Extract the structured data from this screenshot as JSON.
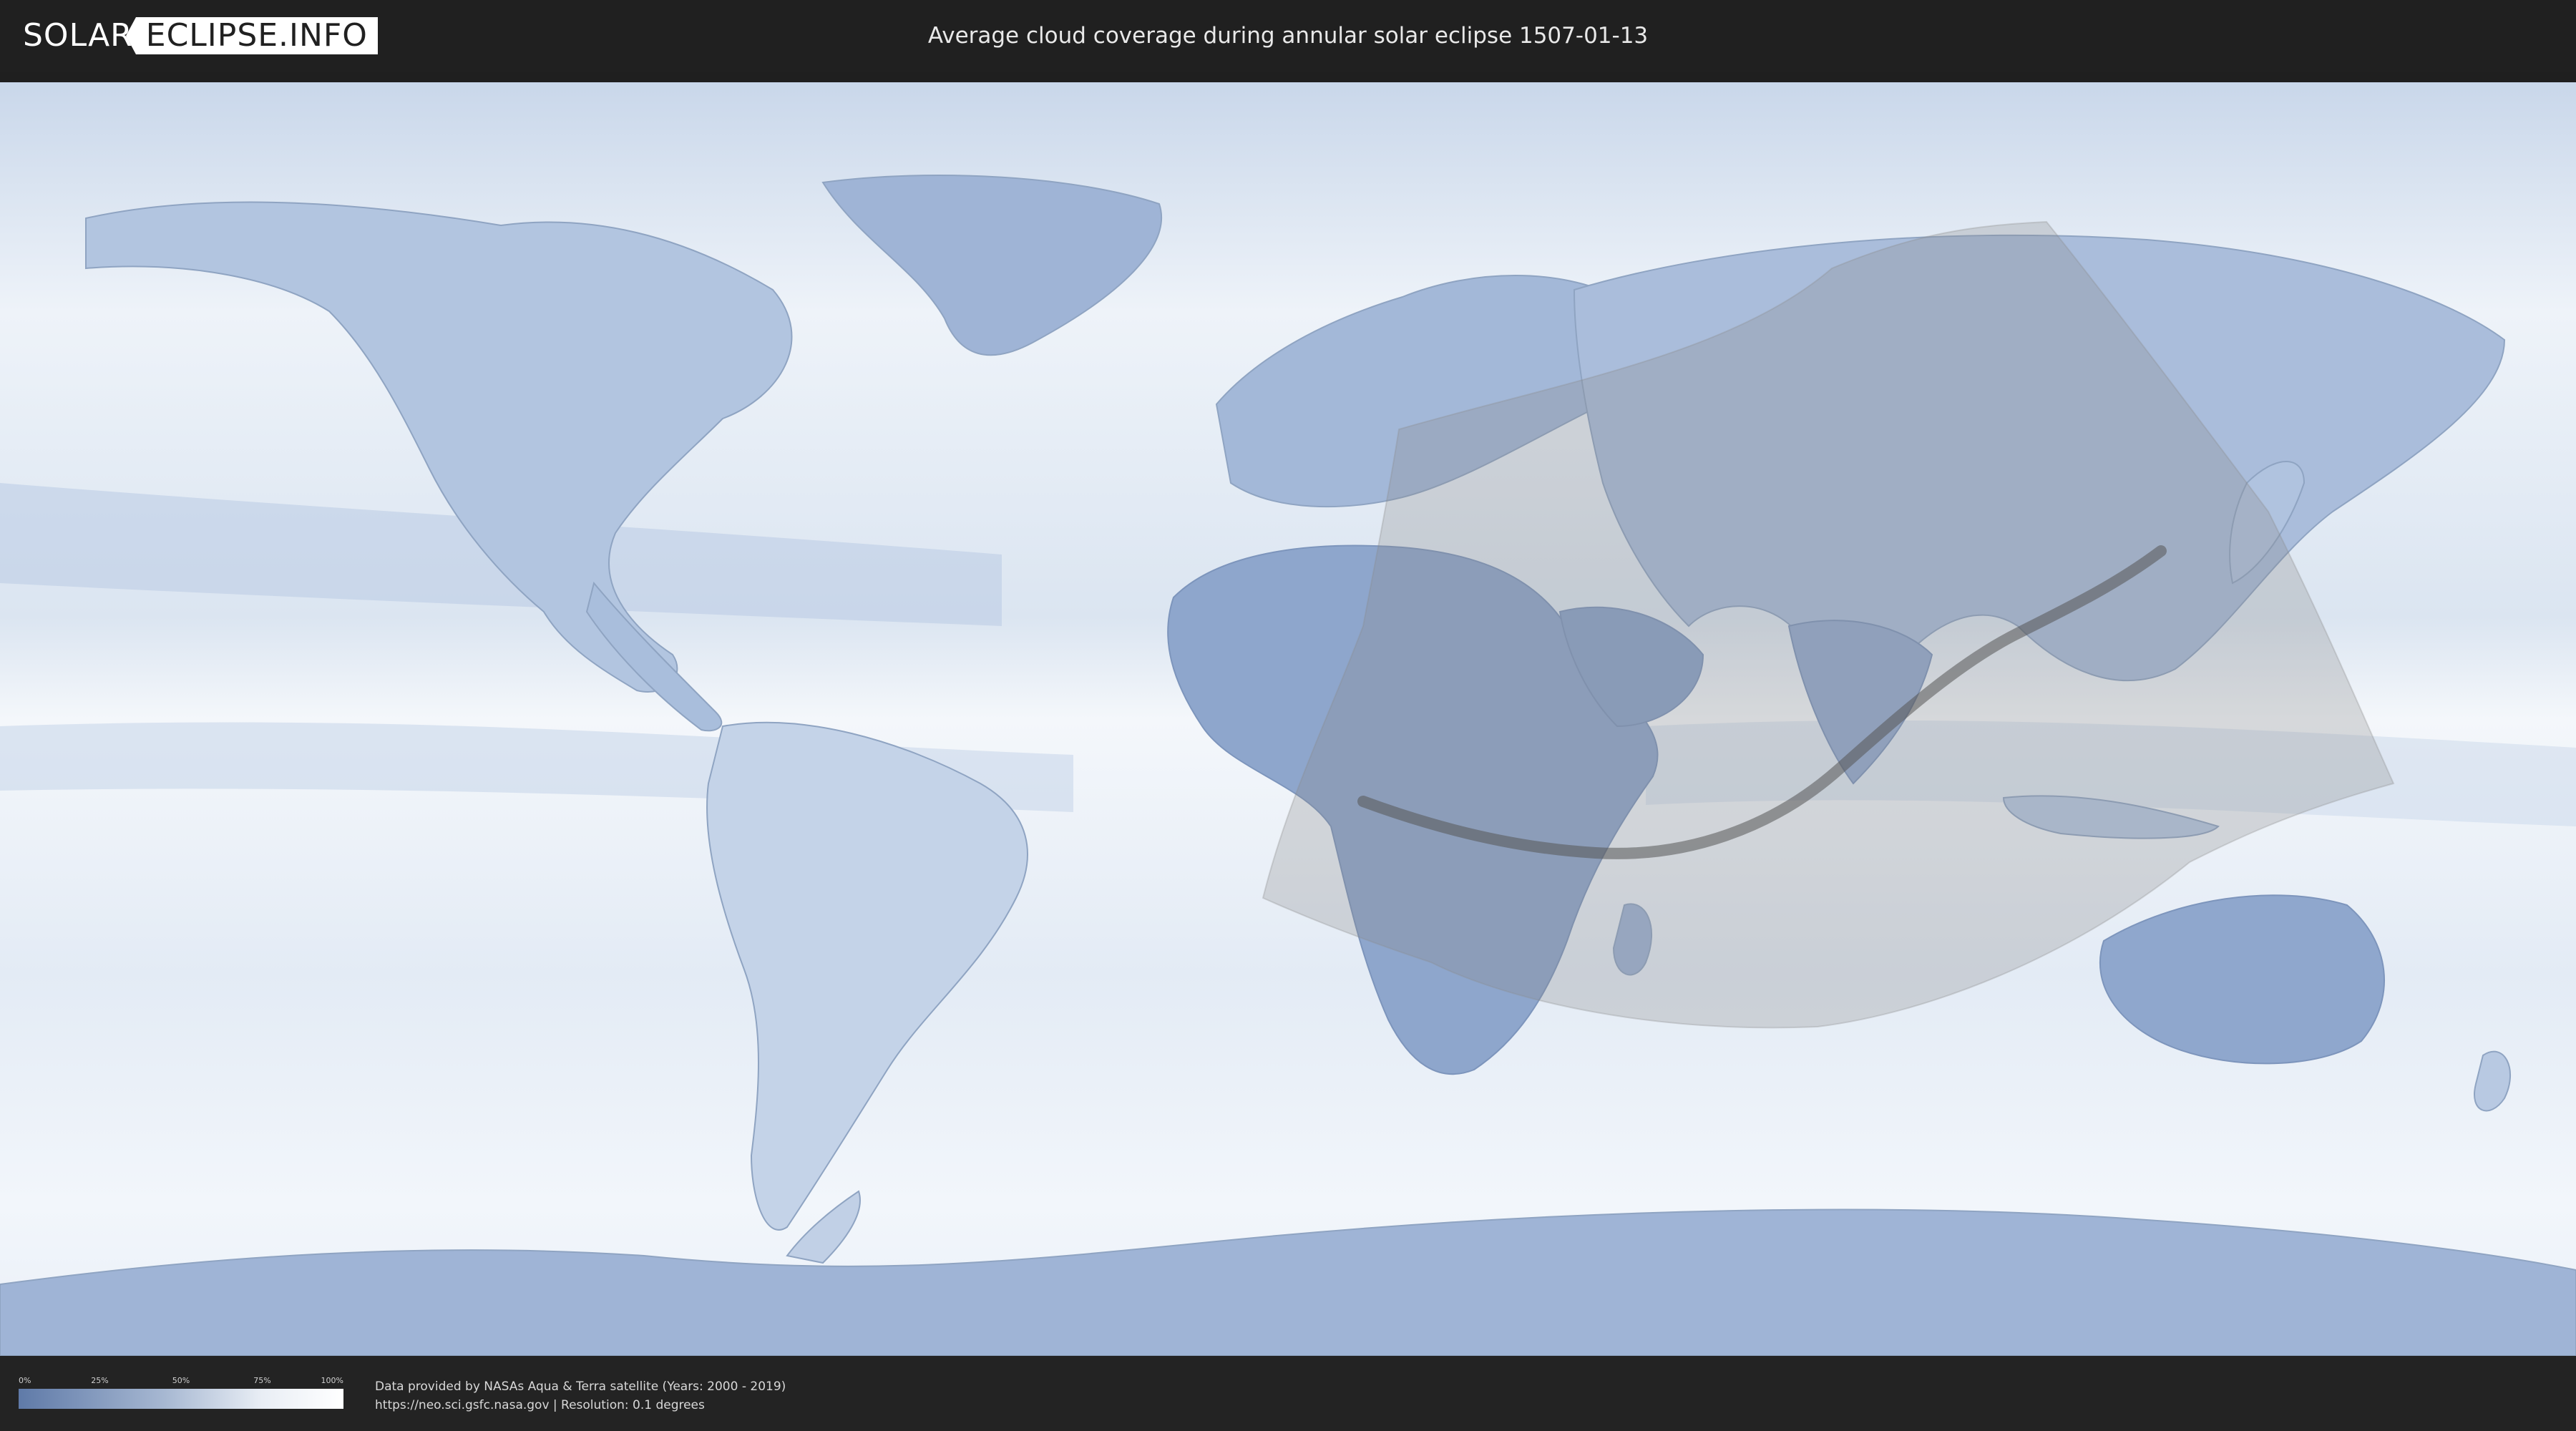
{
  "header": {
    "logo_part1": "SOLAR",
    "logo_part2": "ECLIPSE.INFO",
    "title": "Average cloud coverage during annular solar eclipse 1507-01-13"
  },
  "legend": {
    "ticks": [
      "0%",
      "25%",
      "50%",
      "75%",
      "100%"
    ]
  },
  "credits": {
    "line1": "Data provided by NASAs Aqua & Terra satellite (Years: 2000 - 2019)",
    "line2": "https://neo.sci.gsfc.nasa.gov | Resolution: 0.1 degrees"
  },
  "colors": {
    "header_bg": "#202020",
    "map_ocean": "#e6eef7",
    "land_cloud": "#7f9bc6",
    "eclipse_band": "#9a9a9a",
    "central_line": "#555555"
  }
}
